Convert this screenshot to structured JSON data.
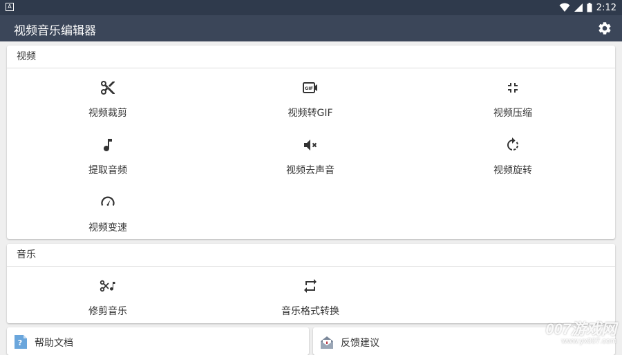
{
  "status_bar": {
    "time": "2:12",
    "app_indicator": "A"
  },
  "app_bar": {
    "title": "视频音乐编辑器",
    "settings_icon": "gear-icon"
  },
  "video_section": {
    "header": "视频",
    "tools": [
      {
        "label": "视频裁剪",
        "icon": "scissors-icon"
      },
      {
        "label": "视频转GIF",
        "icon": "gif-icon"
      },
      {
        "label": "视频压缩",
        "icon": "compress-icon"
      },
      {
        "label": "提取音频",
        "icon": "music-note-icon"
      },
      {
        "label": "视频去声音",
        "icon": "volume-mute-icon"
      },
      {
        "label": "视频旋转",
        "icon": "rotate-icon"
      },
      {
        "label": "视频变速",
        "icon": "speedometer-icon"
      }
    ]
  },
  "music_section": {
    "header": "音乐",
    "tools": [
      {
        "label": "修剪音乐",
        "icon": "music-cut-icon"
      },
      {
        "label": "音乐格式转换",
        "icon": "repeat-icon"
      }
    ]
  },
  "bottom_links": [
    {
      "label": "帮助文档",
      "icon": "help-document-icon"
    },
    {
      "label": "反馈建议",
      "icon": "feedback-mail-icon"
    }
  ],
  "watermark": {
    "line1": "007游戏网",
    "line2": "www.yx007.com"
  },
  "colors": {
    "app_bar": "#3b4659",
    "status_bar": "#2f3a4c",
    "background": "#efefef",
    "card": "#ffffff",
    "icon": "#333333"
  }
}
